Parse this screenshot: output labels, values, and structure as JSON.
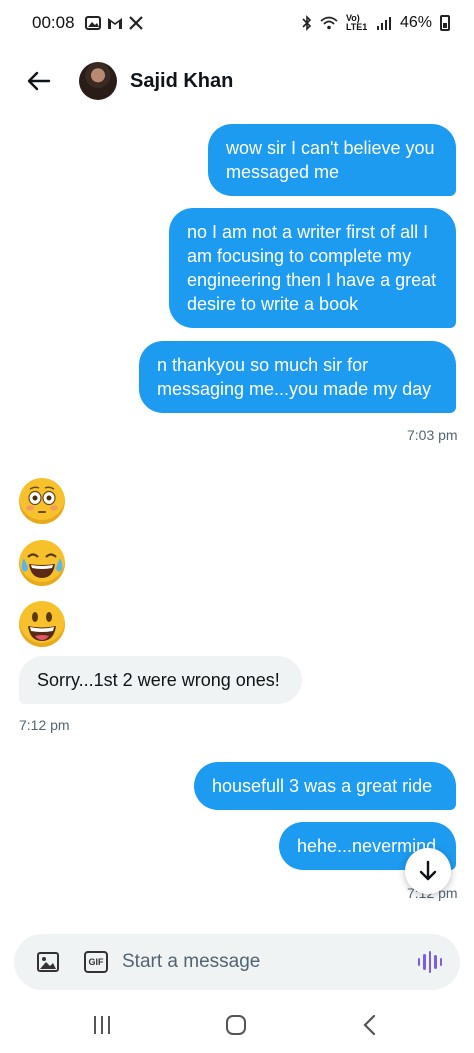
{
  "status_bar": {
    "time": "00:08",
    "network": "Vo) LTE1",
    "battery": "46%"
  },
  "header": {
    "contact_name": "Sajid Khan"
  },
  "messages": {
    "out1": "wow sir I can't believe you messaged me",
    "out2": "no I am not a writer first of all I am focusing to complete my engineering then I have a great desire to write a book",
    "out3": "n thankyou so much sir for messaging me...you made my day",
    "time1": "7:03 pm",
    "in1": "Sorry...1st 2 were wrong ones!",
    "time2": "7:12 pm",
    "out4": "housefull 3 was a great ride",
    "out5": "hehe...nevermind",
    "time3": "7:12 pm"
  },
  "composer": {
    "placeholder": "Start a message",
    "gif_label": "GIF"
  },
  "icons": {
    "back": "arrow-left-icon",
    "image": "image-icon",
    "voice": "voice-wave-icon",
    "scroll": "arrow-down-icon"
  },
  "colors": {
    "outgoing": "#1d9bf0",
    "incoming": "#eff3f4",
    "voice": "#7c5fe0"
  }
}
